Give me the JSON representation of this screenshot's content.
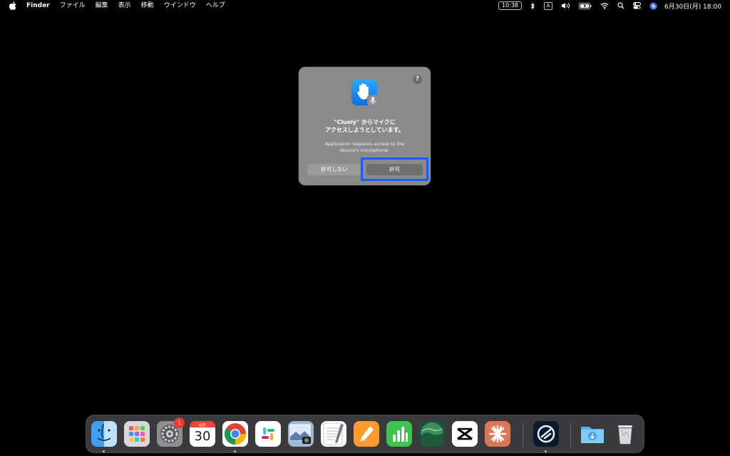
{
  "menubar": {
    "app_name": "Finder",
    "items": [
      "ファイル",
      "編集",
      "表示",
      "移動",
      "ウインドウ",
      "ヘルプ"
    ],
    "status": {
      "screen_time": "10:38",
      "input_source": "A",
      "clock": "6月30日(月)  18:00"
    }
  },
  "dialog": {
    "help": "?",
    "title_line1": "\"Cluely\" からマイクに",
    "title_line2": "アクセスしようとしています。",
    "message_line1": "Application requests access to the",
    "message_line2": "device's microphone.",
    "deny_label": "許可しない",
    "allow_label": "許可"
  },
  "dock": {
    "settings_badge": "1",
    "calendar_month": "6月",
    "calendar_day": "30"
  },
  "colors": {
    "highlight": "#1a5cff",
    "badge": "#f0362e"
  }
}
